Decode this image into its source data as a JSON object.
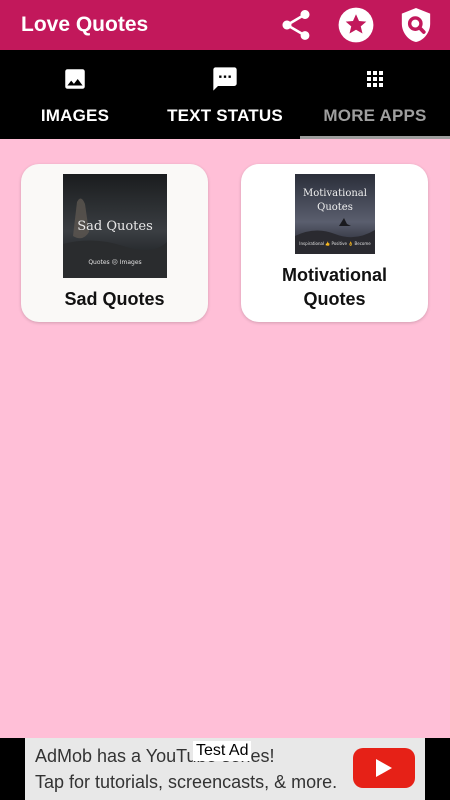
{
  "app_bar": {
    "title": "Love Quotes",
    "background": "#c2185b",
    "actions": [
      {
        "icon": "share-icon"
      },
      {
        "icon": "star-icon"
      },
      {
        "icon": "privacy-shield-icon"
      }
    ]
  },
  "tabs": [
    {
      "label": "IMAGES",
      "icon": "image-icon",
      "selected": false
    },
    {
      "label": "TEXT STATUS",
      "icon": "message-icon",
      "selected": false
    },
    {
      "label": "MORE APPS",
      "icon": "apps-grid-icon",
      "selected": true
    }
  ],
  "apps": [
    {
      "label": "Sad Quotes",
      "thumb_title": "Sad Quotes",
      "thumb_caption": "Quotes 😔 Images"
    },
    {
      "label": "Motivational Quotes",
      "label_line1": "Motivational",
      "label_line2": "Quotes",
      "thumb_title_line1": "Motivational",
      "thumb_title_line2": "Quotes",
      "thumb_caption": "Inspirational 👍 Positive 👌 Become"
    }
  ],
  "ad": {
    "tag": "Test Ad",
    "line1": "AdMob has a YouTube series!",
    "line2": "Tap for tutorials, screencasts, & more.",
    "button_icon": "play-icon"
  },
  "colors": {
    "background": "#ffbfd7",
    "tab_bar": "#000000",
    "selected_tab": "#9e9e9e"
  }
}
